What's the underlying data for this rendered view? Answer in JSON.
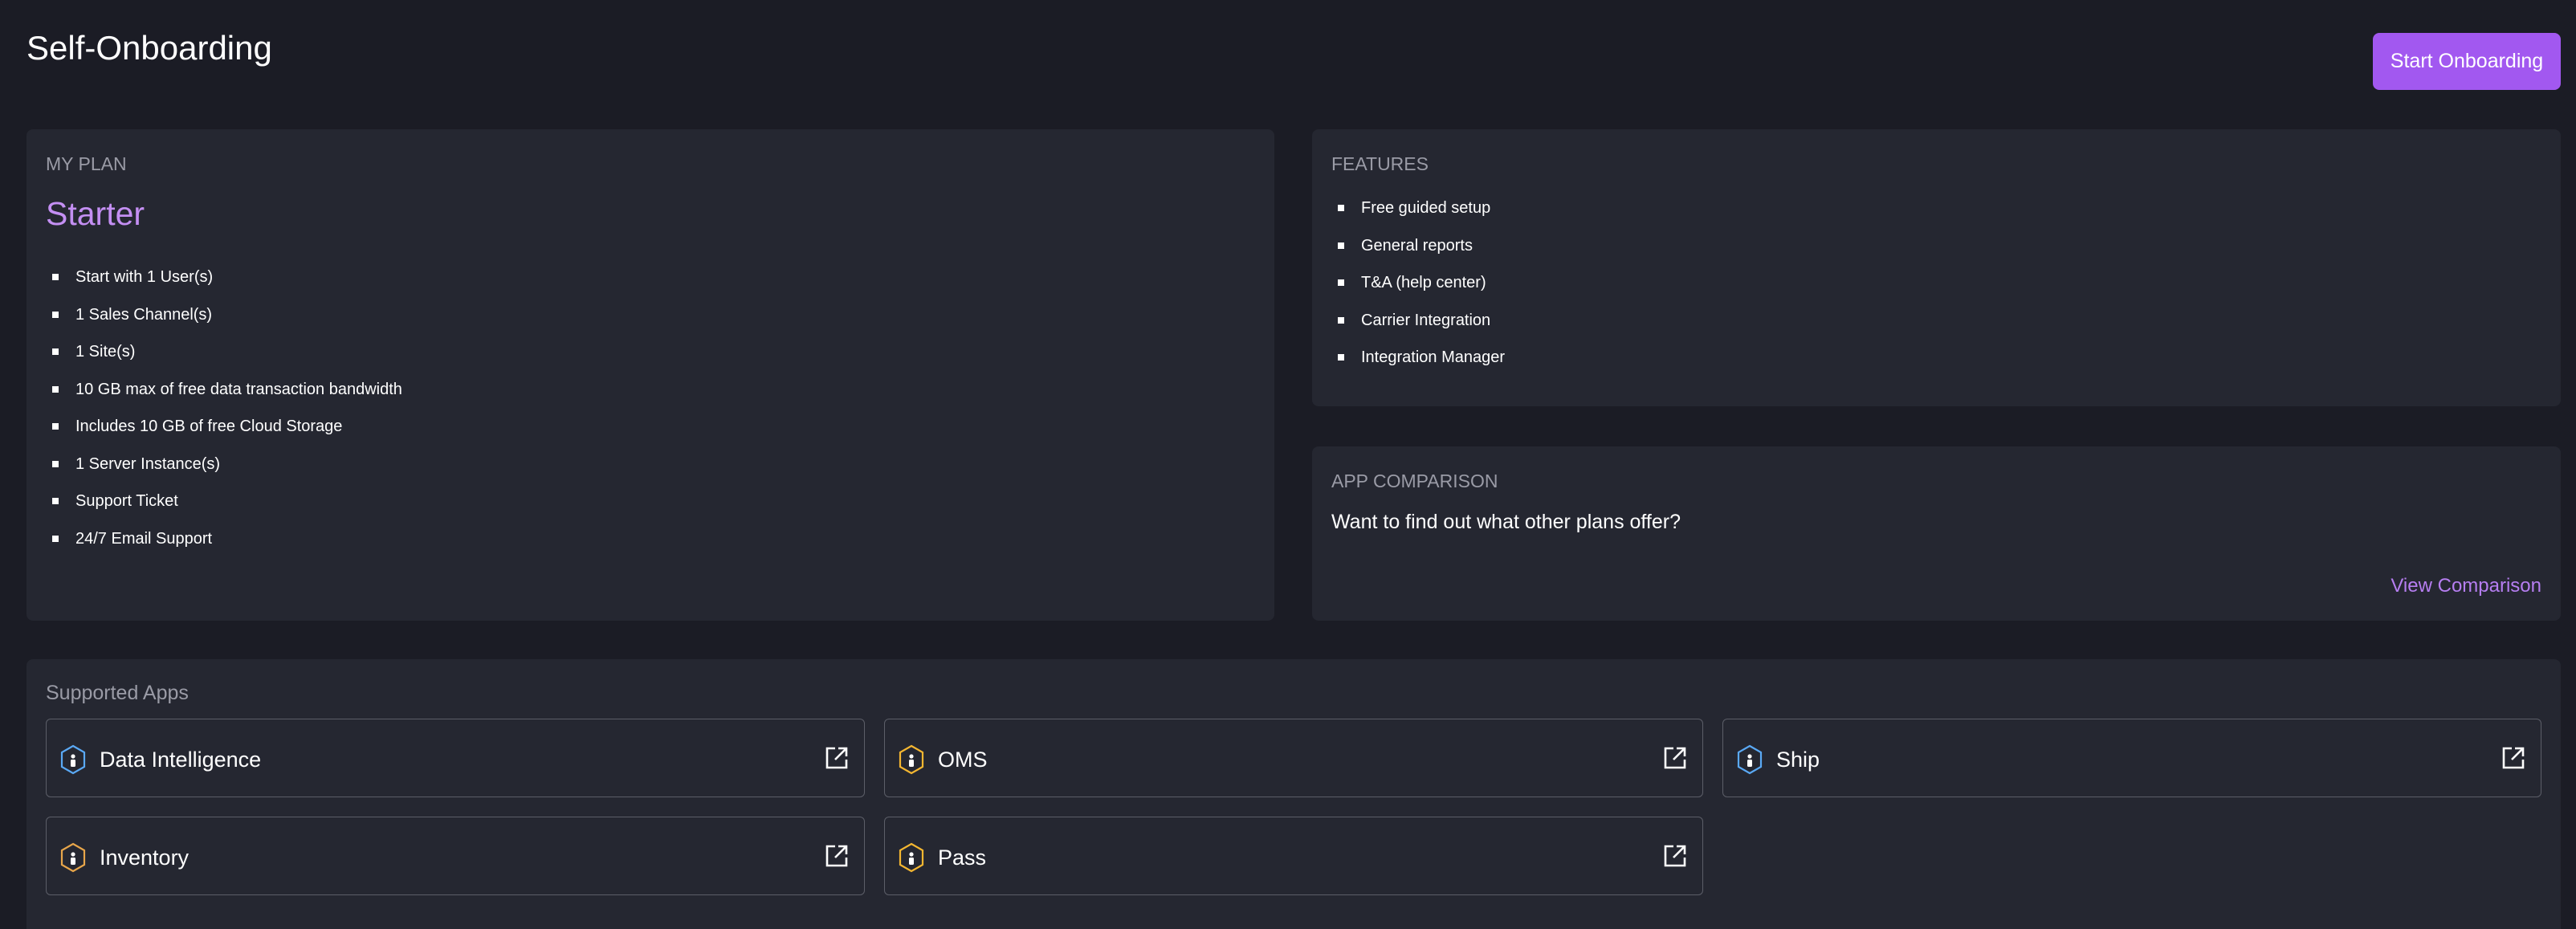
{
  "header": {
    "title": "Self-Onboarding",
    "start_button": "Start Onboarding"
  },
  "plan": {
    "heading": "MY PLAN",
    "name": "Starter",
    "items": [
      "Start with 1 User(s)",
      "1 Sales Channel(s)",
      "1 Site(s)",
      "10 GB max of free data transaction bandwidth",
      "Includes 10 GB of free Cloud Storage",
      "1 Server Instance(s)",
      "Support Ticket",
      "24/7 Email Support"
    ]
  },
  "features": {
    "heading": "FEATURES",
    "items": [
      "Free guided setup",
      "General reports",
      "T&A (help center)",
      "Carrier Integration",
      "Integration Manager"
    ]
  },
  "comparison": {
    "heading": "APP COMPARISON",
    "text": "Want to find out what other plans offer?",
    "link": "View Comparison"
  },
  "apps": {
    "heading": "Supported Apps",
    "items": [
      {
        "label": "Data Intelligence",
        "icon": "hexagon-app-icon",
        "color": "#5aa9f5"
      },
      {
        "label": "OMS",
        "icon": "hexagon-app-icon",
        "color": "#f5b731"
      },
      {
        "label": "Ship",
        "icon": "hexagon-app-icon",
        "color": "#5aa9f5"
      },
      {
        "label": "Inventory",
        "icon": "hexagon-app-icon",
        "color": "#e8a64a"
      },
      {
        "label": "Pass",
        "icon": "hexagon-app-icon",
        "color": "#f5b731"
      }
    ]
  },
  "colors": {
    "background": "#1b1c25",
    "card": "#252731",
    "accent": "#a258f0",
    "plan_name": "#c48ff3",
    "link": "#b67ef1"
  }
}
